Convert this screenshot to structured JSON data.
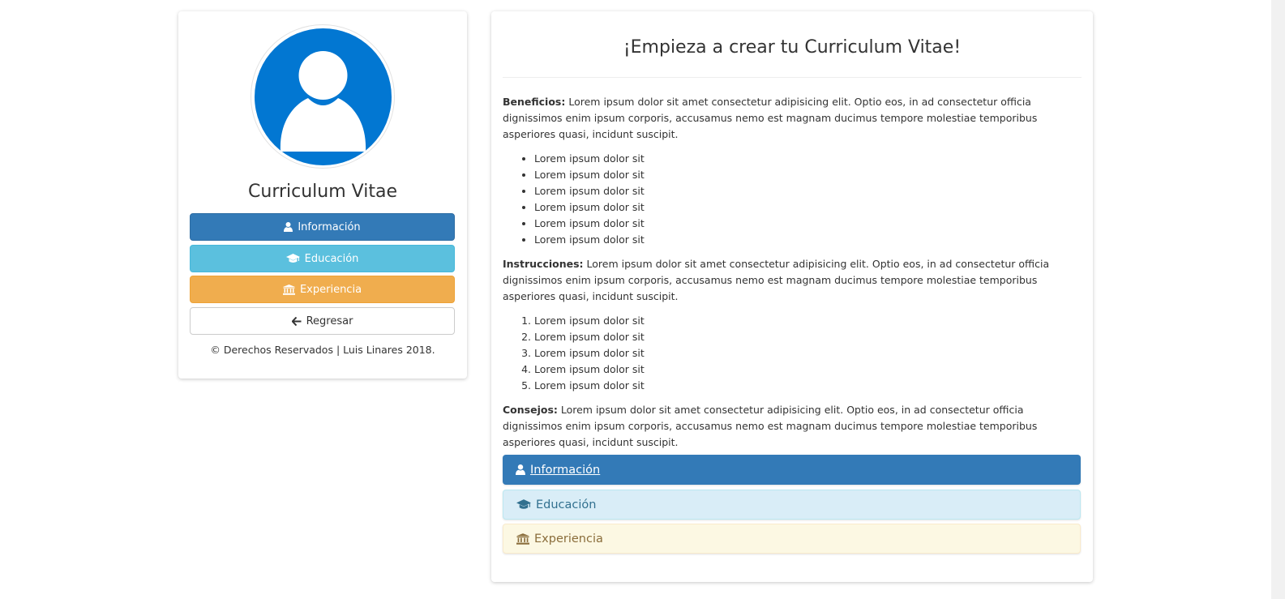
{
  "sidebar": {
    "title": "Curriculum Vitae",
    "buttons": {
      "info": "Información",
      "education": "Educación",
      "experience": "Experiencia",
      "back": "Regresar"
    },
    "copyright": "© Derechos Reservados | Luis Linares 2018."
  },
  "main": {
    "title": "¡Empieza a crear tu Curriculum Vitae!",
    "benefits": {
      "label": "Beneficios:",
      "text": " Lorem ipsum dolor sit amet consectetur adipisicing elit. Optio eos, in ad consectetur officia dignissimos enim ipsum corporis, accusamus nemo est magnam ducimus tempore molestiae temporibus asperiores quasi, incidunt suscipit.",
      "items": [
        "Lorem ipsum dolor sit",
        "Lorem ipsum dolor sit",
        "Lorem ipsum dolor sit",
        "Lorem ipsum dolor sit",
        "Lorem ipsum dolor sit",
        "Lorem ipsum dolor sit"
      ]
    },
    "instructions": {
      "label": "Instrucciones:",
      "text": " Lorem ipsum dolor sit amet consectetur adipisicing elit. Optio eos, in ad consectetur officia dignissimos enim ipsum corporis, accusamus nemo est magnam ducimus tempore molestiae temporibus asperiores quasi, incidunt suscipit.",
      "items": [
        "Lorem ipsum dolor sit",
        "Lorem ipsum dolor sit",
        "Lorem ipsum dolor sit",
        "Lorem ipsum dolor sit",
        "Lorem ipsum dolor sit"
      ]
    },
    "tips": {
      "label": "Consejos:",
      "text": " Lorem ipsum dolor sit amet consectetur adipisicing elit. Optio eos, in ad consectetur officia dignissimos enim ipsum corporis, accusamus nemo est magnam ducimus tempore molestiae temporibus asperiores quasi, incidunt suscipit."
    },
    "panels": {
      "info": "Información",
      "education": "Educación",
      "experience": "Experiencia"
    }
  },
  "icons": {
    "avatar": "user-avatar-icon",
    "user": "user-icon",
    "education": "graduation-cap-icon",
    "experience": "institution-icon",
    "back": "arrow-left-icon"
  },
  "colors": {
    "primary": "#337ab7",
    "info": "#5bc0de",
    "warning": "#f0ad4e",
    "avatar_bg": "#0277d2"
  }
}
